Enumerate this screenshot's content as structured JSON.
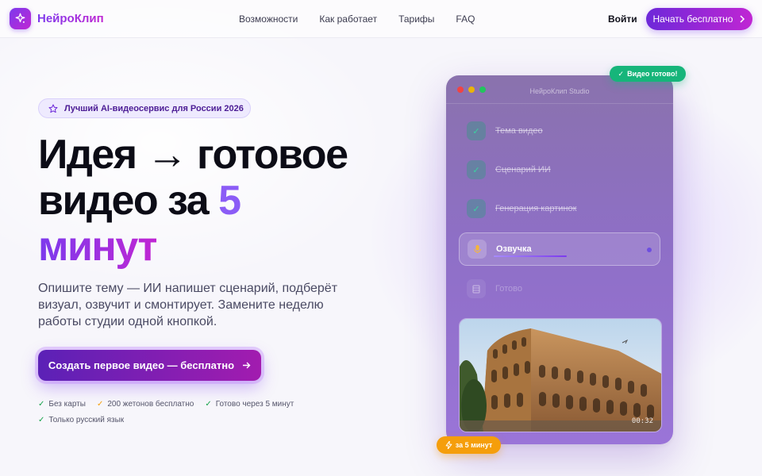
{
  "brand": {
    "name": "НейроКлип"
  },
  "nav": {
    "links": [
      "Возможности",
      "Как работает",
      "Тарифы",
      "FAQ"
    ],
    "login": "Войти",
    "start": "Начать бесплатно"
  },
  "hero": {
    "badge": "Лучший AI-видеосервис для России 2026",
    "title_part1": "Идея → готовое видео за ",
    "title_accent_num": "5",
    "title_accent_word": "минут",
    "subtitle": "Опишите тему — ИИ напишет сценарий, подберёт визуал, озвучит и смонтирует. Замените неделю работы студии одной кнопкой.",
    "cta": "Создать первое видео — бесплатно",
    "perks": [
      "Без карты",
      "200 жетонов бесплатно",
      "Готово через 5 минут",
      "Только русский язык"
    ]
  },
  "studio": {
    "title": "НейроКлип Studio",
    "steps": [
      {
        "label": "Тема видео",
        "state": "done"
      },
      {
        "label": "Сценарий ИИ",
        "state": "done"
      },
      {
        "label": "Генерация картинок",
        "state": "done"
      },
      {
        "label": "Озвучка",
        "state": "active"
      },
      {
        "label": "Готово",
        "state": "pending"
      }
    ],
    "timestamp": "00:32",
    "ready_badge": "Видео готово!",
    "speed_badge": "за 5 минут"
  },
  "colors": {
    "accent": "#7c3aed",
    "accent2": "#c026d3",
    "success": "#16b57a",
    "warning": "#f59e0b"
  }
}
